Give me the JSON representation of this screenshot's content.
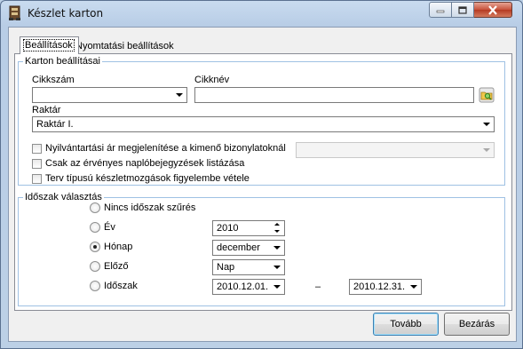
{
  "window": {
    "title": "Készlet karton",
    "app_icon": "inventory-icon"
  },
  "tabs": [
    {
      "label": "Beállítások",
      "active": true
    },
    {
      "label": "Nyomtatási beállítások",
      "active": false
    }
  ],
  "karton": {
    "legend": "Karton beállításai",
    "cikkszam_label": "Cikkszám",
    "cikkszam_value": "",
    "cikknev_label": "Cikknév",
    "cikknev_value": "",
    "lookup_icon": "folder-search-icon",
    "raktar_label": "Raktár",
    "raktar_value": "Raktár I.",
    "checkboxes": [
      {
        "label": "Nyilvántartási ár megjelenítése a kimenő bizonylatoknál",
        "checked": false
      },
      {
        "label": "Csak az érvényes naplóbejegyzések listázása",
        "checked": false
      },
      {
        "label": "Terv típusú készletmozgások figyelembe vétele",
        "checked": false
      }
    ],
    "price_combo_value": ""
  },
  "idoszak": {
    "legend": "Időszak választás",
    "options": [
      {
        "label": "Nincs időszak szűrés",
        "selected": false
      },
      {
        "label": "Év",
        "selected": false
      },
      {
        "label": "Hónap",
        "selected": true
      },
      {
        "label": "Előző",
        "selected": false
      },
      {
        "label": "Időszak",
        "selected": false
      }
    ],
    "year_value": "2010",
    "month_value": "december",
    "prev_value": "Nap",
    "date_from": "2010.12.01.",
    "date_separator": "–",
    "date_to": "2010.12.31."
  },
  "buttons": {
    "next_label": "Tovább",
    "close_label": "Bezárás"
  }
}
